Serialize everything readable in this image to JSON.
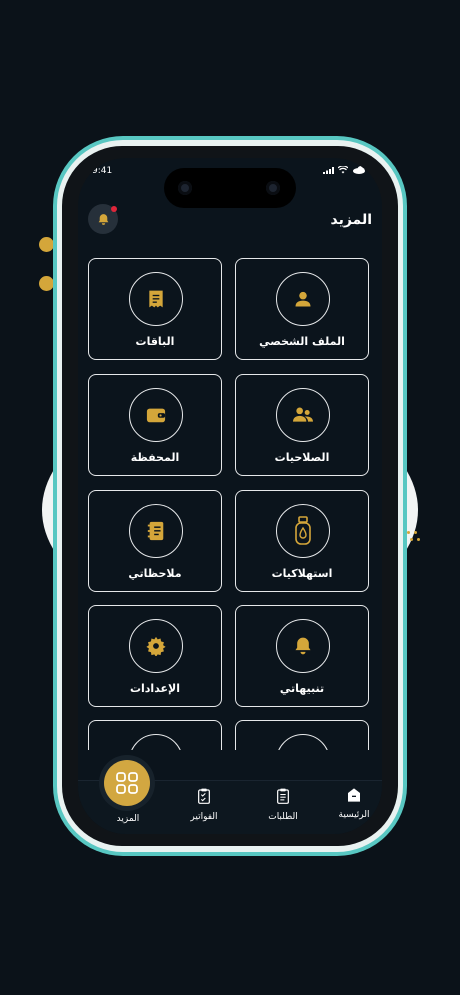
{
  "colors": {
    "accent": "#d4a63a",
    "background": "#0b1219",
    "teal": "#3fbcb8",
    "badge": "#e0263a"
  },
  "status_bar": {
    "time": "9:41"
  },
  "header": {
    "title": "المزيد",
    "bell_icon": "bell-icon"
  },
  "menu": [
    {
      "label": "الملف الشخصي",
      "icon": "user-icon"
    },
    {
      "label": "الباقات",
      "icon": "receipt-icon"
    },
    {
      "label": "الصلاحيات",
      "icon": "users-icon"
    },
    {
      "label": "المحفظة",
      "icon": "wallet-icon"
    },
    {
      "label": "استهلاكيات",
      "icon": "gas-cylinder-icon"
    },
    {
      "label": "ملاحظاتي",
      "icon": "notebook-icon"
    },
    {
      "label": "تنبيهاتي",
      "icon": "bell-icon"
    },
    {
      "label": "الإعدادات",
      "icon": "gear-icon"
    }
  ],
  "tabbar": {
    "home": "الرئيسية",
    "orders": "الطلبات",
    "invoices": "الفواتير",
    "more": "المزيد"
  }
}
